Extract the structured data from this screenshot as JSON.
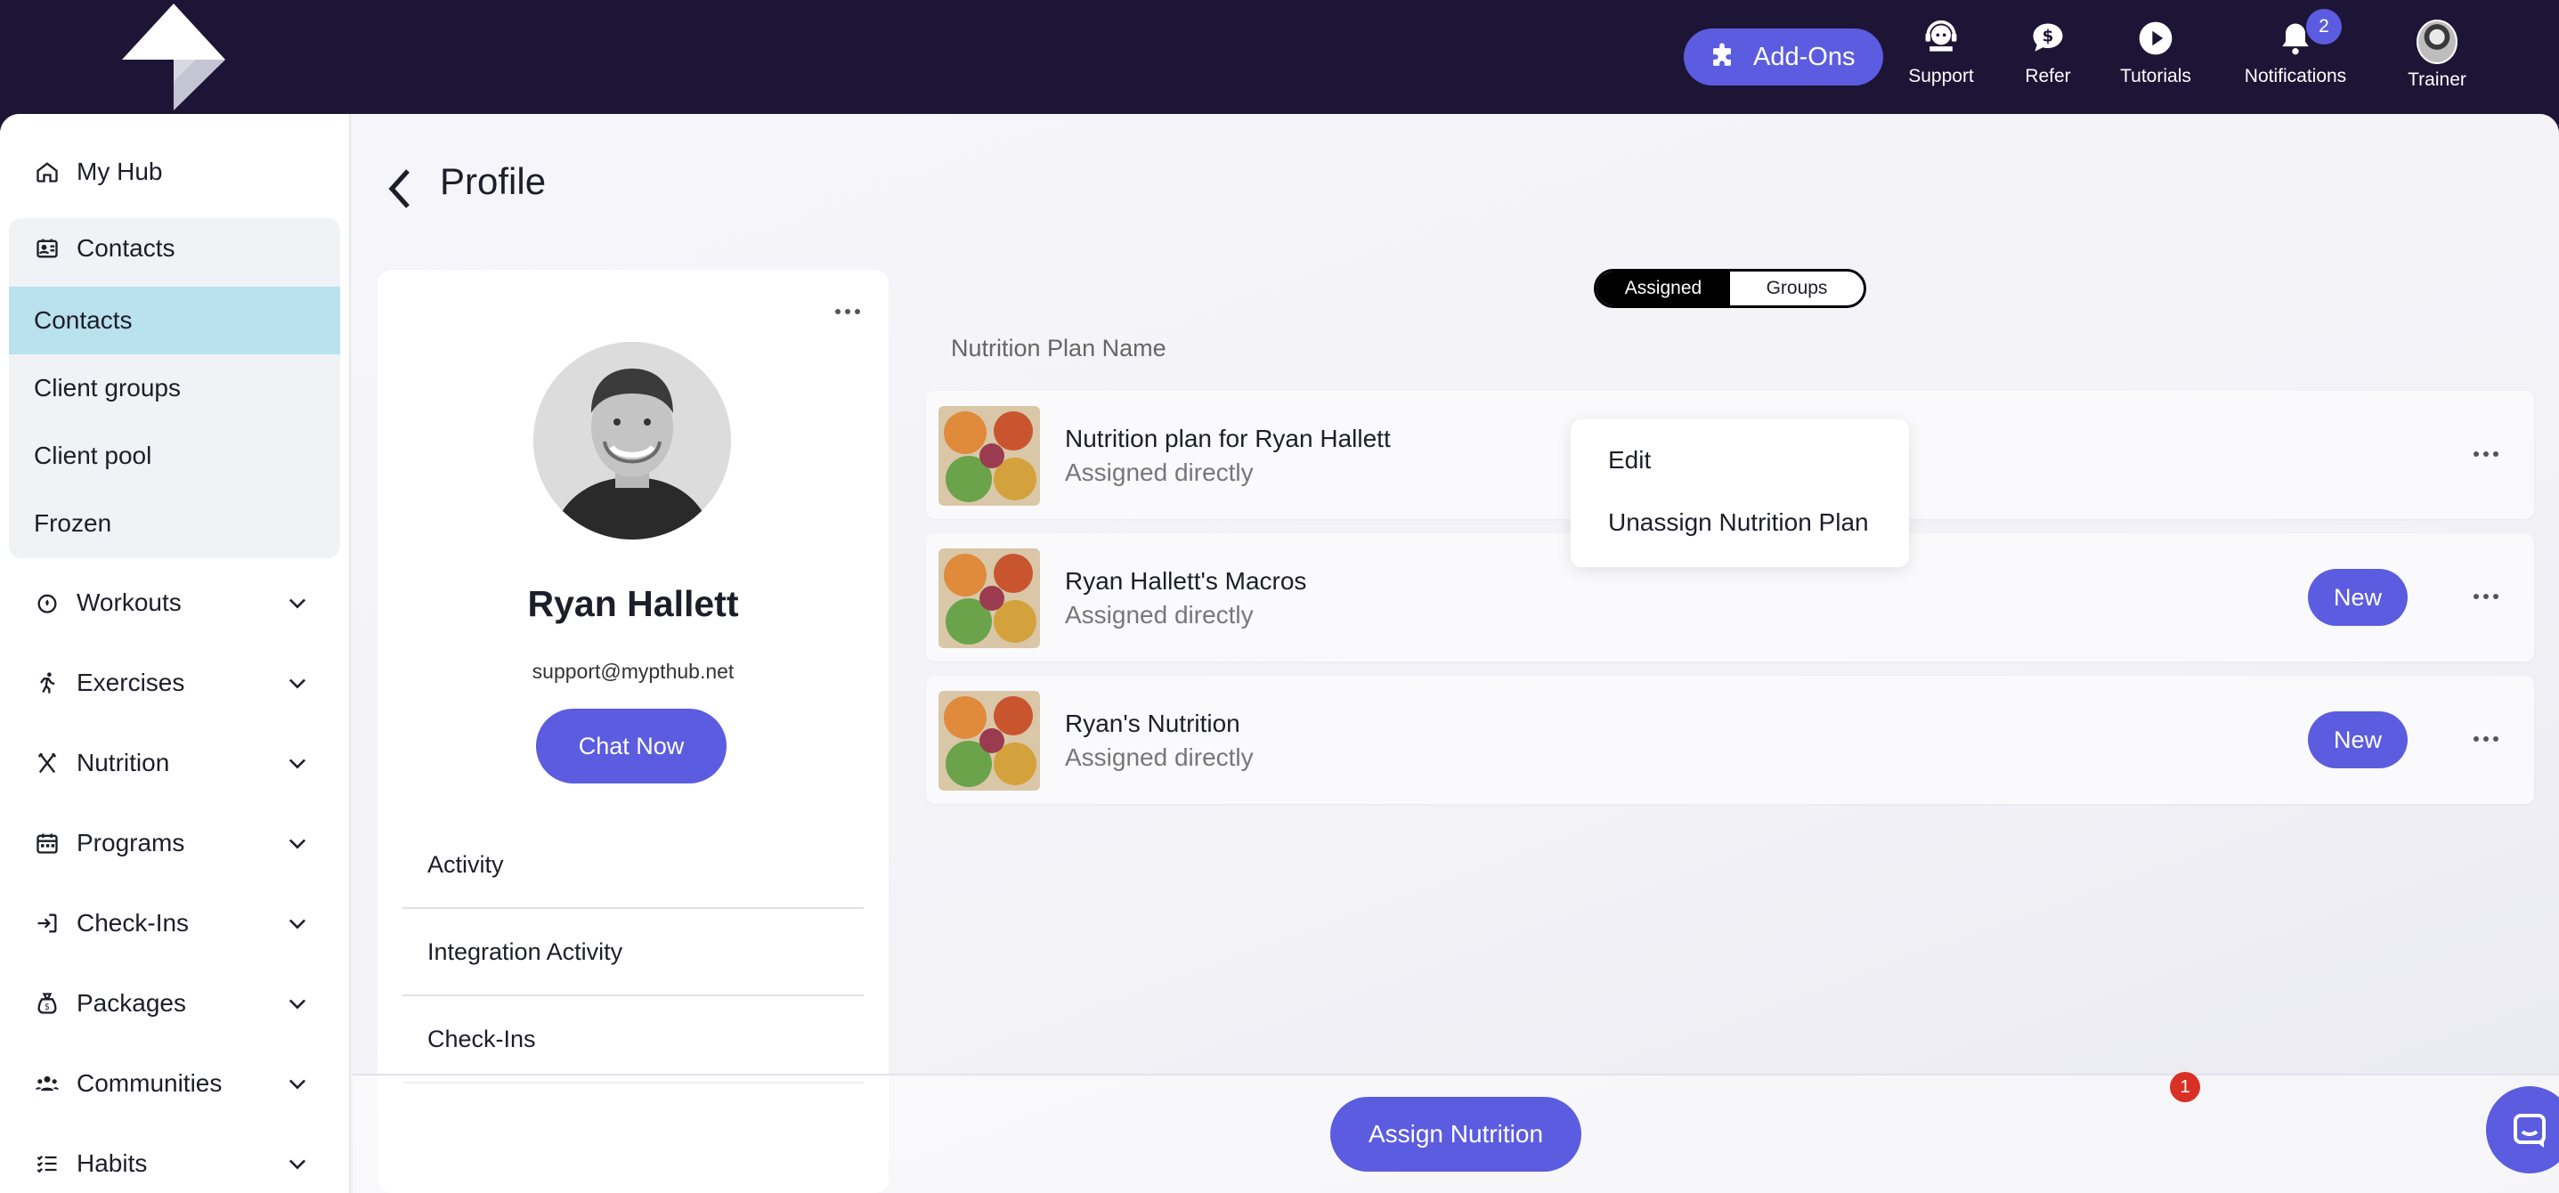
{
  "topbar": {
    "addons_label": "Add-Ons",
    "items": [
      {
        "label": "Support",
        "icon": "support-icon"
      },
      {
        "label": "Refer",
        "icon": "refer-icon"
      },
      {
        "label": "Tutorials",
        "icon": "play-icon"
      },
      {
        "label": "Notifications",
        "icon": "bell-icon",
        "badge": "2"
      },
      {
        "label": "Trainer",
        "icon": "avatar"
      }
    ]
  },
  "sidebar": {
    "my_hub": "My Hub",
    "contacts_header": "Contacts",
    "contacts_sub": [
      "Contacts",
      "Client groups",
      "Client pool",
      "Frozen"
    ],
    "sections": [
      "Workouts",
      "Exercises",
      "Nutrition",
      "Programs",
      "Check-Ins",
      "Packages",
      "Communities",
      "Habits"
    ]
  },
  "page": {
    "title": "Profile"
  },
  "profile": {
    "name": "Ryan Hallett",
    "email": "support@mypthub.net",
    "chat_label": "Chat Now",
    "rows": [
      "Activity",
      "Integration Activity",
      "Check-Ins"
    ]
  },
  "segmented": {
    "assigned": "Assigned",
    "groups": "Groups",
    "active": "Assigned"
  },
  "plans": {
    "column_header": "Nutrition Plan Name",
    "rows": [
      {
        "title": "Nutrition plan for Ryan Hallett",
        "subtitle": "Assigned directly",
        "badge": ""
      },
      {
        "title": "Ryan Hallett's Macros",
        "subtitle": "Assigned directly",
        "badge": "New"
      },
      {
        "title": "Ryan's Nutrition",
        "subtitle": "Assigned directly",
        "badge": "New"
      }
    ]
  },
  "context_menu": {
    "edit": "Edit",
    "unassign": "Unassign Nutrition Plan"
  },
  "footer": {
    "assign_label": "Assign Nutrition",
    "chat_badge": "1"
  },
  "colors": {
    "topbar_bg": "#1d1536",
    "accent": "#5c5ce0",
    "active_item_bg": "#b9e1ee",
    "alert_badge": "#d93025"
  }
}
